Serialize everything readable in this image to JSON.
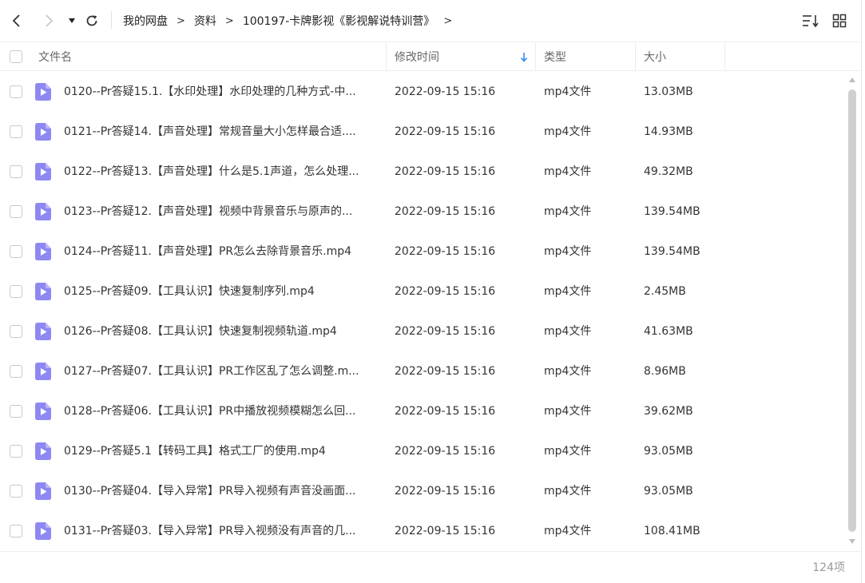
{
  "breadcrumb": [
    "我的网盘",
    "资料",
    "100197-卡牌影视《影视解说特训营》"
  ],
  "breadcrumb_sep": ">",
  "columns": {
    "name": "文件名",
    "modified": "修改时间",
    "type": "类型",
    "size": "大小"
  },
  "sort": {
    "column": "modified",
    "direction": "desc"
  },
  "files": [
    {
      "name": "0120--Pr答疑15.1.【水印处理】水印处理的几种方式-中...",
      "modified": "2022-09-15 15:16",
      "type": "mp4文件",
      "size": "13.03MB"
    },
    {
      "name": "0121--Pr答疑14.【声音处理】常规音量大小怎样最合适....",
      "modified": "2022-09-15 15:16",
      "type": "mp4文件",
      "size": "14.93MB"
    },
    {
      "name": "0122--Pr答疑13.【声音处理】什么是5.1声道，怎么处理...",
      "modified": "2022-09-15 15:16",
      "type": "mp4文件",
      "size": "49.32MB"
    },
    {
      "name": "0123--Pr答疑12.【声音处理】视频中背景音乐与原声的...",
      "modified": "2022-09-15 15:16",
      "type": "mp4文件",
      "size": "139.54MB"
    },
    {
      "name": "0124--Pr答疑11.【声音处理】PR怎么去除背景音乐.mp4",
      "modified": "2022-09-15 15:16",
      "type": "mp4文件",
      "size": "139.54MB"
    },
    {
      "name": "0125--Pr答疑09.【工具认识】快速复制序列.mp4",
      "modified": "2022-09-15 15:16",
      "type": "mp4文件",
      "size": "2.45MB"
    },
    {
      "name": "0126--Pr答疑08.【工具认识】快速复制视频轨道.mp4",
      "modified": "2022-09-15 15:16",
      "type": "mp4文件",
      "size": "41.63MB"
    },
    {
      "name": "0127--Pr答疑07.【工具认识】PR工作区乱了怎么调整.m...",
      "modified": "2022-09-15 15:16",
      "type": "mp4文件",
      "size": "8.96MB"
    },
    {
      "name": "0128--Pr答疑06.【工具认识】PR中播放视频模糊怎么回...",
      "modified": "2022-09-15 15:16",
      "type": "mp4文件",
      "size": "39.62MB"
    },
    {
      "name": "0129--Pr答疑5.1【转码工具】格式工厂的使用.mp4",
      "modified": "2022-09-15 15:16",
      "type": "mp4文件",
      "size": "93.05MB"
    },
    {
      "name": "0130--Pr答疑04.【导入异常】PR导入视频有声音没画面...",
      "modified": "2022-09-15 15:16",
      "type": "mp4文件",
      "size": "93.05MB"
    },
    {
      "name": "0131--Pr答疑03.【导入异常】PR导入视频没有声音的几...",
      "modified": "2022-09-15 15:16",
      "type": "mp4文件",
      "size": "108.41MB"
    }
  ],
  "item_count": "124项",
  "colors": {
    "video_icon": "#8d88f2",
    "sort_arrow": "#2f8ef4",
    "scroll_thumb": "#cfcfcf"
  },
  "icons": {
    "back": "chevron-left-icon",
    "forward": "chevron-right-icon",
    "history": "caret-down-icon",
    "refresh": "refresh-icon",
    "sort": "sort-list-icon",
    "view": "grid-view-icon",
    "file": "video-file-icon"
  }
}
